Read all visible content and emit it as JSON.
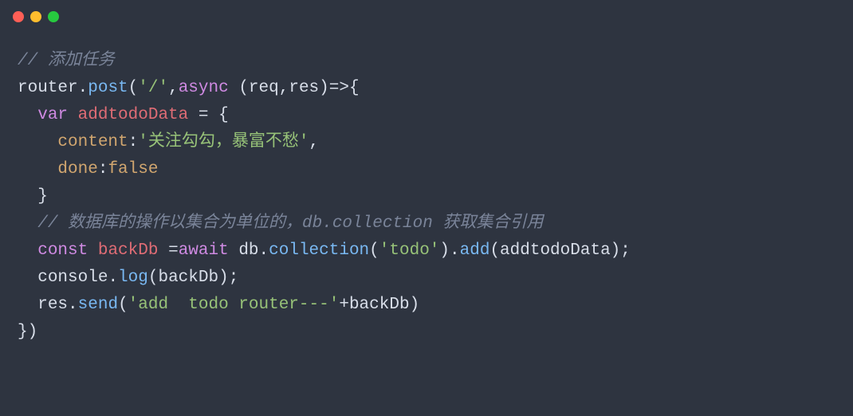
{
  "code": {
    "c1": "// 添加任务",
    "l2": {
      "r": "router",
      "d1": ".",
      "f": "post",
      "p1": "(",
      "s": "'/'",
      "c1": ",",
      "kw": "async",
      "sp": " ",
      "p2": "(",
      "a1": "req",
      "c2": ",",
      "a2": "res",
      "p3": ")",
      "ar": "=>{"
    },
    "l3": {
      "kw": "var",
      "v": "addtodoData",
      "eq": " = ",
      "ob": "{"
    },
    "l4": {
      "k": "content",
      "c": ":",
      "s": "'关注勾勾，暴富不愁'",
      "e": ","
    },
    "l5": {
      "k": "done",
      "c": ":",
      "b": "false"
    },
    "l6": {
      "cb": "}"
    },
    "c2": "// 数据库的操作以集合为单位的，db.collection 获取集合引用",
    "l8": {
      "kw": "const",
      "v": "backDb",
      "eq": " =",
      "aw": "await",
      "sp": " ",
      "o": "db",
      "d1": ".",
      "f1": "collection",
      "p1": "(",
      "s": "'todo'",
      "p2": ")",
      "d2": ".",
      "f2": "add",
      "p3": "(",
      "a": "addtodoData",
      "p4": ");"
    },
    "l9": {
      "o": "console",
      "d": ".",
      "f": "log",
      "p1": "(",
      "a": "backDb",
      "p2": ");"
    },
    "l10": {
      "o": "res",
      "d": ".",
      "f": "send",
      "p1": "(",
      "s": "'add  todo router---'",
      "plus": "+",
      "a": "backDb",
      "p2": ")"
    },
    "l11": {
      "cb": "})"
    }
  }
}
